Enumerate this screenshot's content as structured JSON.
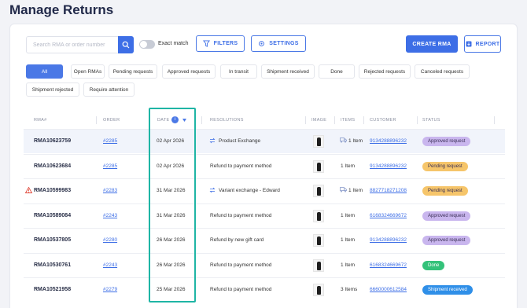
{
  "page": {
    "title": "Manage Returns"
  },
  "toolbar": {
    "search_placeholder": "Search RMA or order number",
    "exact_match": "Exact match",
    "filters": "FILTERS",
    "settings": "SETTINGS",
    "create_rma": "CREATE RMA",
    "report": "REPORT"
  },
  "filters": [
    "All",
    "Open RMAs",
    "Pending requests",
    "Approved requests",
    "In transit",
    "Shipment received",
    "Done",
    "Rejected requests",
    "Canceled requests",
    "Shipment rejected",
    "Require attention"
  ],
  "columns": [
    "RMA#",
    "ORDER",
    "DATE",
    "RESOLUTIONS",
    "IMAGE",
    "ITEMS",
    "CUSTOMER",
    "STATUS"
  ],
  "date_info_icon": "i",
  "rows": [
    {
      "rma": "RMA10623759",
      "order": "#2285",
      "date": "02 Apr 2026",
      "resolution": "Product Exchange",
      "res_icon": "exchange-icon",
      "items": "1 Item",
      "items_icon": "truck-icon",
      "customer": "9134288896232",
      "status": "Approved request",
      "status_color": "#c9b6ee",
      "alert": false
    },
    {
      "rma": "RMA10623684",
      "order": "#2285",
      "date": "02 Apr 2026",
      "resolution": "Refund to payment method",
      "res_icon": "",
      "items": "1 Item",
      "items_icon": "",
      "customer": "9134288896232",
      "status": "Pending request",
      "status_color": "#f6c56a",
      "alert": false
    },
    {
      "rma": "RMA10599983",
      "order": "#2283",
      "date": "31 Mar 2026",
      "resolution": "Variant exchange - Edward",
      "res_icon": "exchange-icon",
      "items": "1 Item",
      "items_icon": "truck-icon",
      "customer": "8827718271208",
      "status": "Pending request",
      "status_color": "#f6c56a",
      "alert": true
    },
    {
      "rma": "RMA10589084",
      "order": "#2243",
      "date": "31 Mar 2026",
      "resolution": "Refund to payment method",
      "res_icon": "",
      "items": "1 Item",
      "items_icon": "",
      "customer": "6168324669672",
      "status": "Approved request",
      "status_color": "#c9b6ee",
      "alert": false
    },
    {
      "rma": "RMA10537805",
      "order": "#2280",
      "date": "26 Mar 2026",
      "resolution": "Refund by new gift card",
      "res_icon": "",
      "items": "1 Item",
      "items_icon": "",
      "customer": "9134288896232",
      "status": "Approved request",
      "status_color": "#c9b6ee",
      "alert": false
    },
    {
      "rma": "RMA10530761",
      "order": "#2243",
      "date": "26 Mar 2026",
      "resolution": "Refund to payment method",
      "res_icon": "",
      "items": "1 Item",
      "items_icon": "",
      "customer": "6168324669672",
      "status": "Done",
      "status_color": "#34c27a",
      "alert": false
    },
    {
      "rma": "RMA10521958",
      "order": "#2279",
      "date": "25 Mar 2026",
      "resolution": "Refund to payment method",
      "res_icon": "",
      "items": "3 Items",
      "items_icon": "",
      "customer": "6660000612584",
      "status": "Shipment received",
      "status_color": "#2f8fe8",
      "alert": false
    }
  ],
  "colors": {
    "accent": "#3d6ee6",
    "highlight": "#1fb5a5"
  }
}
